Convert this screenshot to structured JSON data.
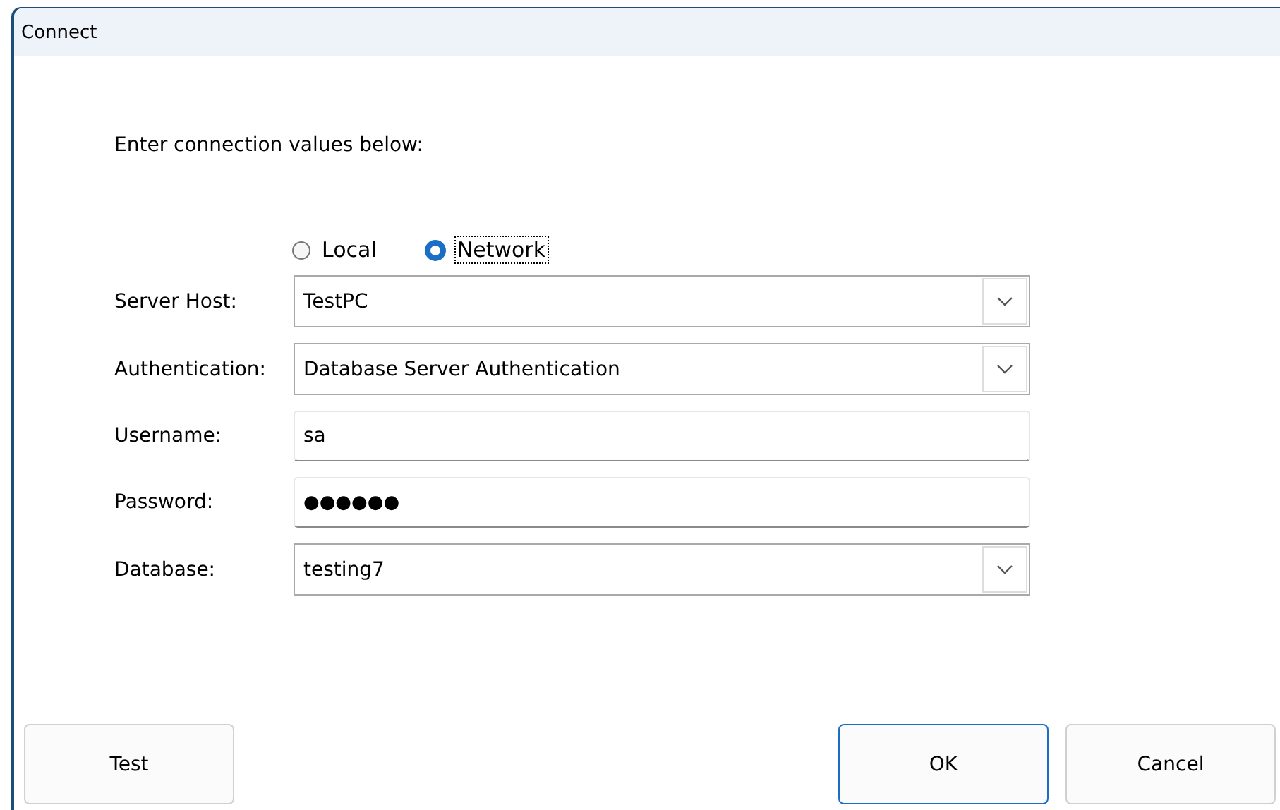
{
  "window": {
    "title": "Connect"
  },
  "instructions": "Enter connection values below:",
  "location_options": [
    {
      "label": "Local",
      "selected": false,
      "focused": false
    },
    {
      "label": "Network",
      "selected": true,
      "focused": true
    }
  ],
  "fields": [
    {
      "kind": "combo",
      "label": "Server Host:",
      "value": "TestPC"
    },
    {
      "kind": "combo",
      "label": "Authentication:",
      "value": "Database Server Authentication"
    },
    {
      "kind": "text",
      "label": "Username:",
      "value": "sa"
    },
    {
      "kind": "password",
      "label": "Password:",
      "value": "●●●●●●"
    },
    {
      "kind": "combo",
      "label": "Database:",
      "value": "testing7"
    }
  ],
  "buttons": [
    {
      "label": "Test",
      "default": false
    },
    {
      "label": "OK",
      "default": true
    },
    {
      "label": "Cancel",
      "default": false
    }
  ]
}
